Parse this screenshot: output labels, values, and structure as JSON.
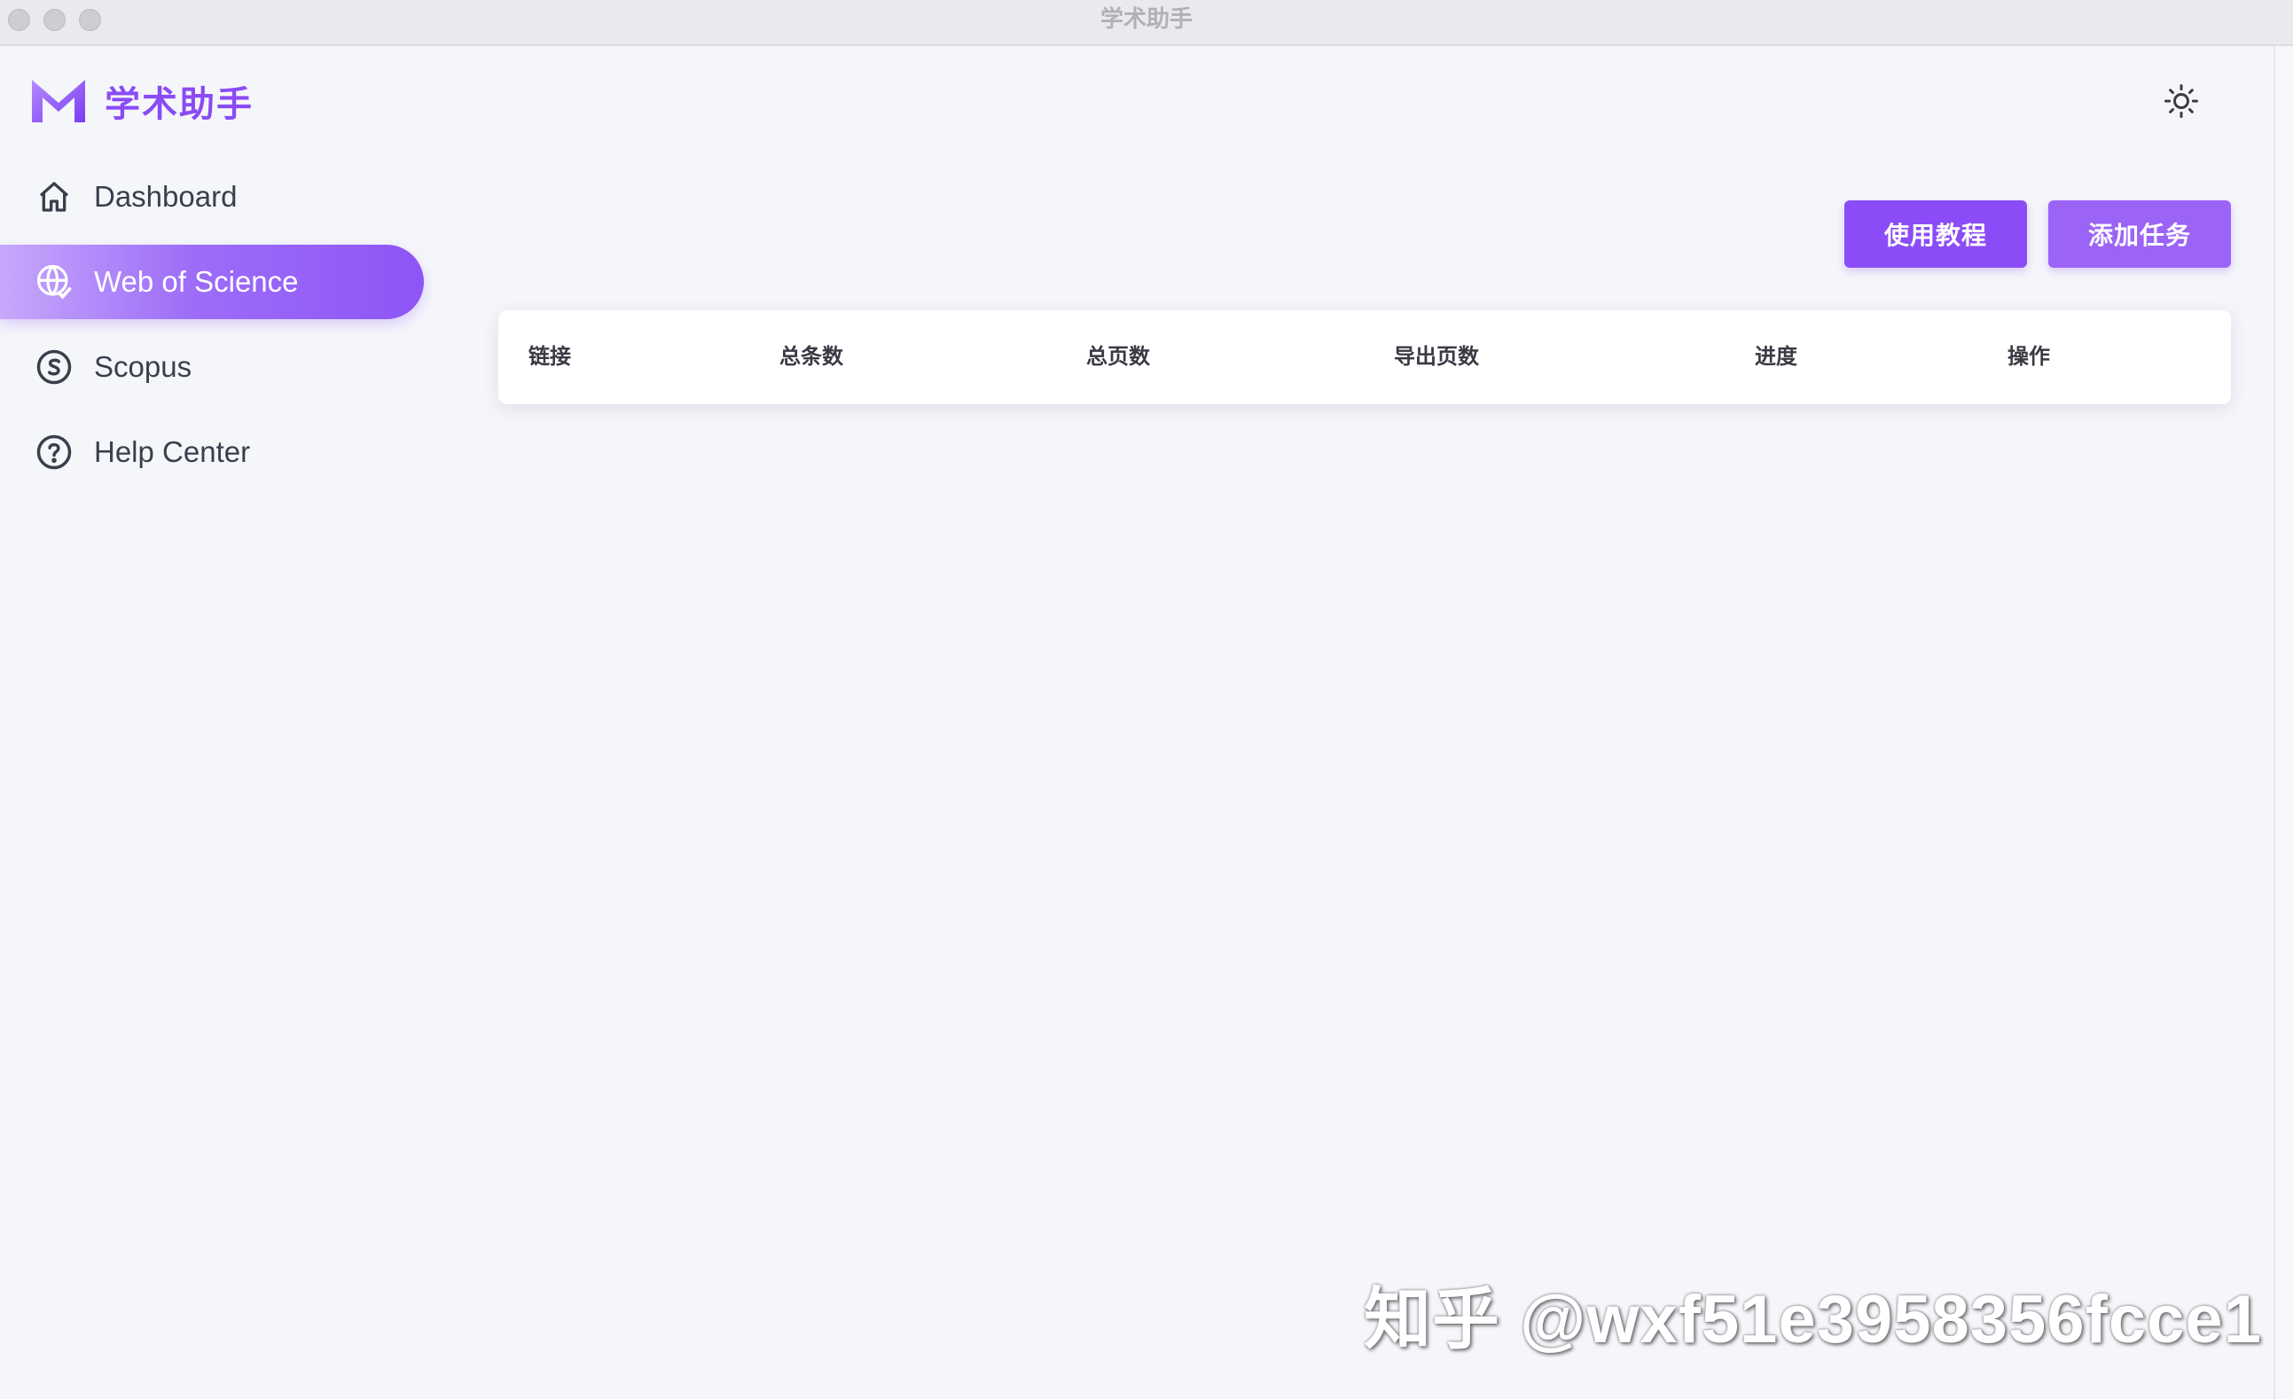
{
  "window": {
    "title": "学术助手"
  },
  "brand": {
    "name": "学术助手",
    "logo_icon": "m-logo-icon",
    "accent_color": "#8a4bf5"
  },
  "sidebar": {
    "items": [
      {
        "label": "Dashboard",
        "icon": "home-icon",
        "active": false
      },
      {
        "label": "Web of Science",
        "icon": "globe-check-icon",
        "active": true
      },
      {
        "label": "Scopus",
        "icon": "scopus-s-icon",
        "active": false
      },
      {
        "label": "Help Center",
        "icon": "help-circle-icon",
        "active": false
      }
    ]
  },
  "header": {
    "theme_toggle_icon": "sun-icon"
  },
  "toolbar": {
    "tutorial_label": "使用教程",
    "add_task_label": "添加任务"
  },
  "table": {
    "columns": [
      "链接",
      "总条数",
      "总页数",
      "导出页数",
      "进度",
      "操作"
    ],
    "rows": []
  },
  "watermark": {
    "text": "知乎 @wxf51e3958356fcce1"
  }
}
